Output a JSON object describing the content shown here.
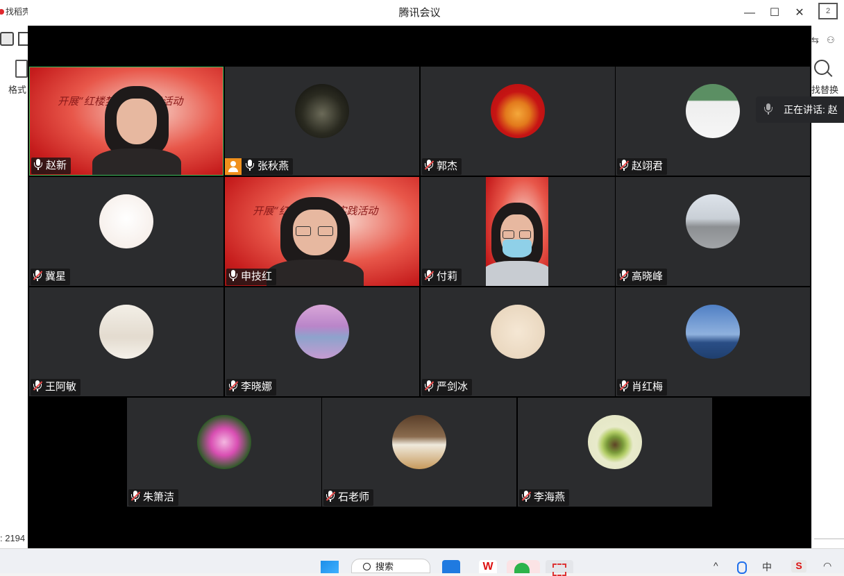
{
  "background_app": {
    "tab_label": "找稻壳",
    "format_label": "格式",
    "count_label": ": 2194",
    "replace_label": "找替换",
    "top_badge": "2"
  },
  "window": {
    "title": "腾讯会议",
    "minimize": "—",
    "maximize": "☐",
    "close": "✕"
  },
  "speaking_indicator": "正在讲话: 赵",
  "participants": [
    {
      "name": "赵新",
      "type": "video",
      "muted": false
    },
    {
      "name": "张秋燕",
      "type": "avatar",
      "muted": false,
      "host": true,
      "avatar": "camel-statue"
    },
    {
      "name": "郭杰",
      "type": "avatar",
      "muted": true,
      "avatar": "tiger"
    },
    {
      "name": "赵翊君",
      "type": "avatar",
      "muted": true,
      "avatar": "cat-under-globe"
    },
    {
      "name": "冀星",
      "type": "avatar",
      "muted": true,
      "avatar": "sketch-girl"
    },
    {
      "name": "申技红",
      "type": "video",
      "muted": false
    },
    {
      "name": "付莉",
      "type": "video",
      "muted": true
    },
    {
      "name": "高晓峰",
      "type": "avatar",
      "muted": true,
      "avatar": "stadium-photo"
    },
    {
      "name": "王阿敏",
      "type": "avatar",
      "muted": true,
      "avatar": "winter-trees"
    },
    {
      "name": "李晓娜",
      "type": "avatar",
      "muted": true,
      "avatar": "purple-sky"
    },
    {
      "name": "严剑冰",
      "type": "avatar",
      "muted": true,
      "avatar": "cartoon-umbrella"
    },
    {
      "name": "肖红梅",
      "type": "avatar",
      "muted": true,
      "avatar": "sea-horizon"
    },
    {
      "name": "朱箫洁",
      "type": "avatar",
      "muted": true,
      "avatar": "pink-flower"
    },
    {
      "name": "石老师",
      "type": "avatar",
      "muted": true,
      "avatar": "white-goose"
    },
    {
      "name": "李海燕",
      "type": "avatar",
      "muted": true,
      "avatar": "avocado"
    }
  ],
  "video_banner_text": "开展“红楼梦”教育实践活动",
  "taskbar": {
    "search_label": "搜索",
    "wps_label": "W",
    "tray_wps": "S",
    "tray_ime": "中",
    "tray_up": "^"
  }
}
